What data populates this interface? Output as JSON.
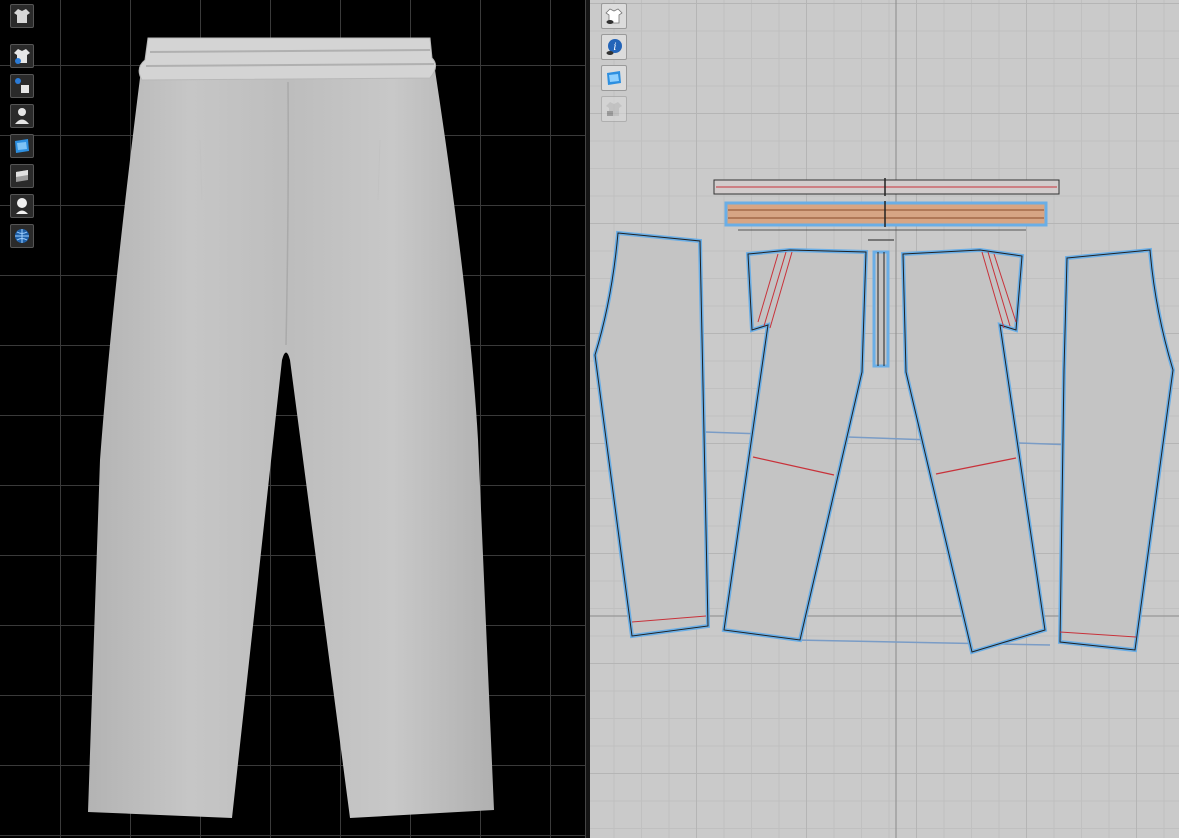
{
  "viewport_3d": {
    "toolbar": [
      {
        "name": "garment-display-icon"
      },
      {
        "name": "garment-visibility-icon"
      },
      {
        "name": "avatar-arrangement-icon"
      },
      {
        "name": "avatar-display-icon"
      },
      {
        "name": "texture-display-icon"
      },
      {
        "name": "fabric-render-icon"
      },
      {
        "name": "avatar-silhouette-icon"
      },
      {
        "name": "environment-globe-icon"
      }
    ]
  },
  "viewport_2d": {
    "toolbar": [
      {
        "name": "show-garment-icon"
      },
      {
        "name": "piece-info-icon"
      },
      {
        "name": "texture-2d-icon"
      },
      {
        "name": "lock-piece-icon"
      }
    ],
    "pattern_pieces": [
      "waistband-top",
      "waistband-bottom",
      "left-back-leg",
      "left-front-leg",
      "fly-strip",
      "right-front-leg",
      "right-back-leg"
    ]
  },
  "colors": {
    "selection_outline": "#6aaee6",
    "fabric_fill": "#c4c4c4",
    "waistband_fill": "#d7a584",
    "seam_line": "#c8323a",
    "garment_3d": "#bdbdbd"
  }
}
